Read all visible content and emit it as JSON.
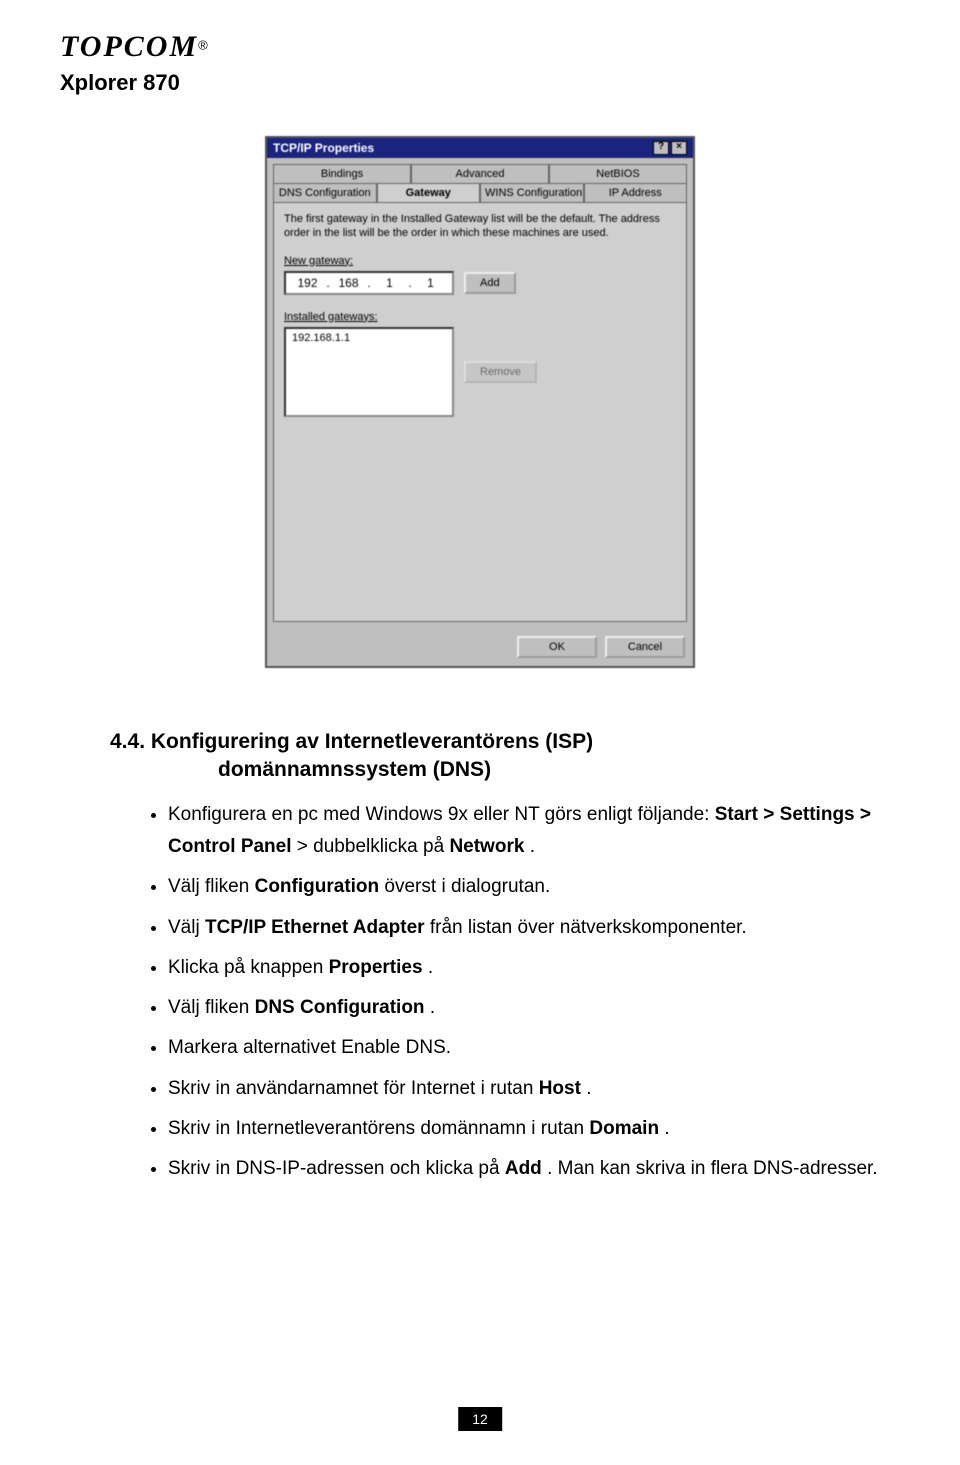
{
  "brand": {
    "name": "TOPCOM",
    "reg": "®"
  },
  "product": "Xplorer 870",
  "dialog": {
    "title": "TCP/IP Properties",
    "help_btn": "?",
    "close_btn": "×",
    "tabs_row1": [
      "Bindings",
      "Advanced",
      "NetBIOS"
    ],
    "tabs_row2": [
      "DNS Configuration",
      "Gateway",
      "WINS Configuration",
      "IP Address"
    ],
    "active_tab": "Gateway",
    "desc": "The first gateway in the Installed Gateway list will be the default. The address order in the list will be the order in which these machines are used.",
    "new_gw_label": "New gateway:",
    "new_gw": [
      "192",
      "168",
      "1",
      "1"
    ],
    "add_btn": "Add",
    "installed_label": "Installed gateways:",
    "installed_item": "192.168.1.1",
    "remove_btn": "Remove",
    "ok": "OK",
    "cancel": "Cancel"
  },
  "section": {
    "number": "4.4.",
    "title_line1": "Konfigurering av Internetleverantörens (ISP)",
    "title_line2": "domännamnssystem (DNS)"
  },
  "bullets": {
    "b1a": "Konfigurera en pc med Windows 9x eller NT görs enligt följande: ",
    "b1b": "Start > Settings > Control Panel",
    "b1c": " > dubbelklicka på ",
    "b1d": "Network",
    "b1e": ".",
    "b2a": "Välj fliken ",
    "b2b": "Configuration",
    "b2c": " överst i dialogrutan.",
    "b3a": "Välj ",
    "b3b": "TCP/IP Ethernet Adapter",
    "b3c": " från listan över nätverkskomponenter.",
    "b4a": "Klicka på knappen ",
    "b4b": "Properties",
    "b4c": ".",
    "b5a": "Välj fliken ",
    "b5b": "DNS Configuration",
    "b5c": ".",
    "b6": "Markera alternativet Enable DNS.",
    "b7a": "Skriv in användarnamnet för Internet i rutan ",
    "b7b": "Host",
    "b7c": ".",
    "b8a": "Skriv in Internetleverantörens domännamn i rutan ",
    "b8b": "Domain",
    "b8c": ".",
    "b9a": "Skriv in DNS-IP-adressen och klicka på ",
    "b9b": "Add",
    "b9c": ". Man kan skriva in flera DNS-adresser."
  },
  "page_number": "12"
}
